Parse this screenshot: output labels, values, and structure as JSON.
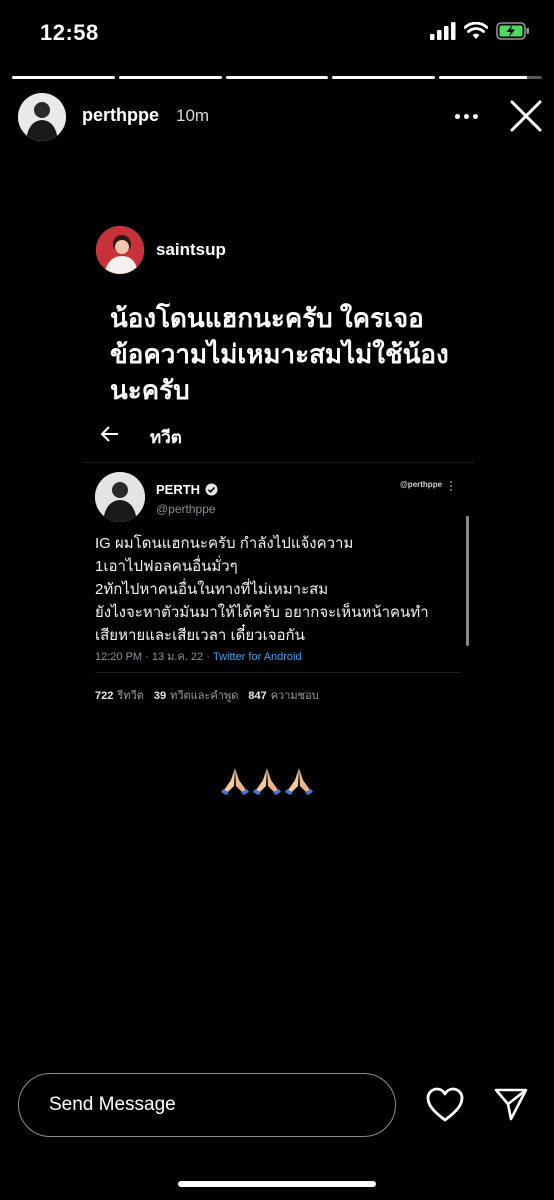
{
  "status_bar": {
    "time": "12:58"
  },
  "story": {
    "progress": [
      1,
      1,
      1,
      1,
      0.85
    ],
    "username": "perthppe",
    "time_ago": "10m"
  },
  "post": {
    "username": "saintsup",
    "caption_lines": [
      "น้องโดนแฮกนะครับ ใครเจอ",
      "ข้อความไม่เหมาะสมไม่ใช้น้อง",
      "นะครับ"
    ]
  },
  "tweet": {
    "heading": "ทวีต",
    "name": "PERTH",
    "handle": "@perthppe",
    "handle_watermark": "@perthppe",
    "body_lines": [
      "IG ผมโดนแฮกนะครับ กำลังไปแจ้งความ",
      "1เอาไปฟอลคนอื่นมั่วๆ",
      "2ทักไปหาคนอื่นในทางที่ไม่เหมาะสม",
      "ยังไงจะหาตัวมันมาให้ได้ครับ อยากจะเห็นหน้าคนทำ",
      "เสียหายและเสียเวลา เดี๋ยวเจอกัน"
    ],
    "timestamp": "12:20 PM · 13 ม.ค. 22 · ",
    "source": "Twitter for Android",
    "stats": {
      "retweets_count": "722",
      "retweets_label": "รีทวีต",
      "quotes_count": "39",
      "quotes_label": "ทวีตและคำพูด",
      "likes_count": "847",
      "likes_label": "ความชอบ"
    }
  },
  "emoji": "🙏🏻🙏🏻🙏🏻",
  "bottom": {
    "message_placeholder": "Send Message"
  },
  "colors": {
    "background": "#000000",
    "link": "#4a9de5",
    "battery": "#4cd964"
  }
}
